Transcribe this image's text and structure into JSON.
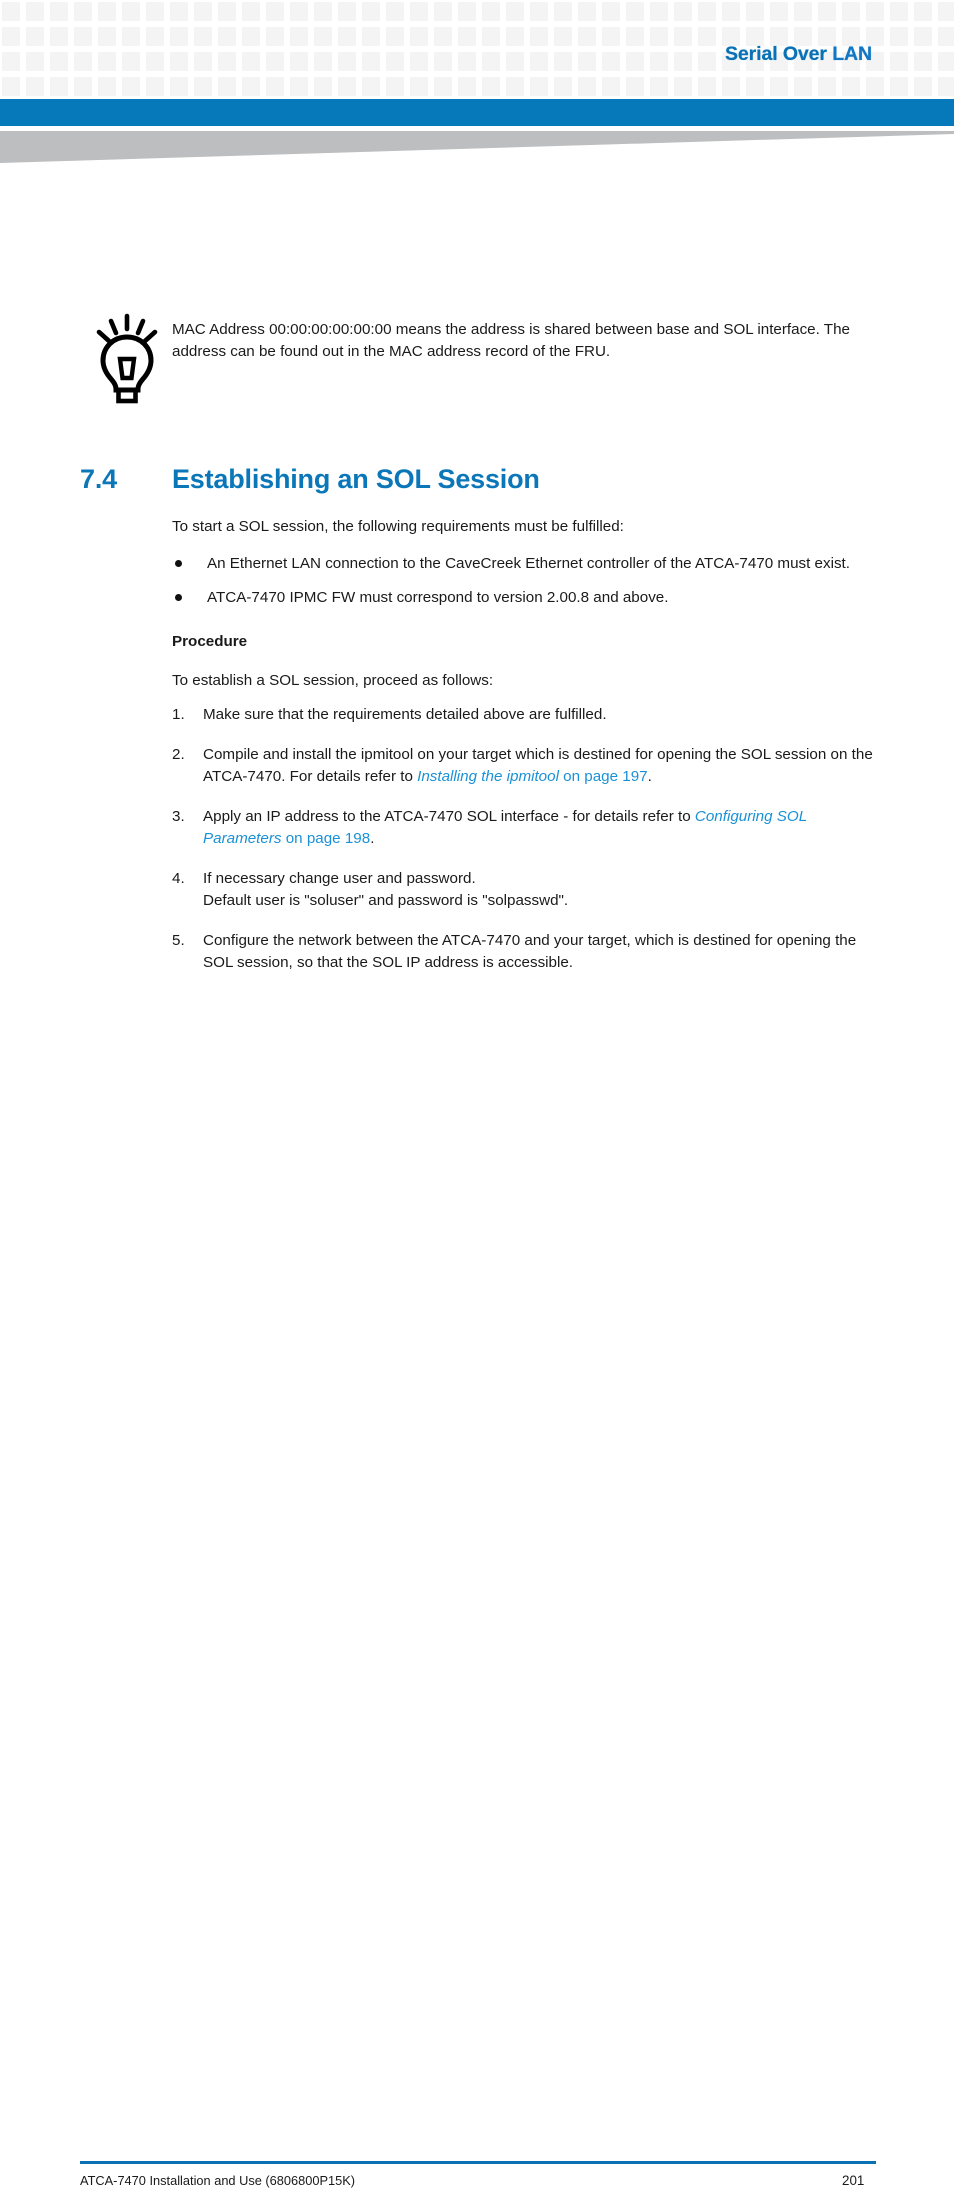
{
  "header": {
    "running_title": "Serial Over LAN",
    "running_title_head": "Serial Over ",
    "running_title_tail": "LAN",
    "accent_blue": "#0579ba",
    "title_blue": "#0a72b4",
    "wedge_gray": "#bcbec0",
    "grid_square_color": "#f4f4f4"
  },
  "tip": {
    "icon": "lightbulb-icon",
    "text": "MAC Address 00:00:00:00:00:00 means the address is shared between base and SOL interface. The address can be found out in the MAC address record of the FRU."
  },
  "section": {
    "number": "7.4",
    "title": "Establishing an SOL Session",
    "heading_color": "#0b77b8"
  },
  "body": {
    "intro": "To start a SOL session, the following requirements must be fulfilled:",
    "bullets": [
      "An Ethernet LAN connection to the CaveCreek Ethernet controller of the ATCA-7470 must exist.",
      "ATCA-7470 IPMC FW must correspond to version 2.00.8 and above."
    ],
    "procedure_heading": "Procedure",
    "procedure_intro": "To establish a SOL session, proceed as follows:",
    "steps": [
      {
        "num": "1.",
        "text": "Make sure that the requirements detailed above are fulfilled."
      },
      {
        "num": "2.",
        "text_before": "Compile and install the ipmitool on your target which is destined for opening the SOL session on the ATCA-7470. For details refer to ",
        "xref_italic": "Installing the ipmitool",
        "xref_plain": " on page 197",
        "text_after": "."
      },
      {
        "num": "3.",
        "text_before": "Apply an IP address to the ATCA-7470 SOL interface - for details refer to ",
        "xref_italic": "Configuring SOL Parameters",
        "xref_plain": " on page 198",
        "text_after": "."
      },
      {
        "num": "4.",
        "text": "If necessary change user and password.",
        "text_line2": "Default user is \"soluser\" and password is \"solpasswd\"."
      },
      {
        "num": "5.",
        "text": "Configure the network between the ATCA-7470 and your target, which is destined for opening the SOL session, so that the SOL IP address is accessible."
      }
    ],
    "link_color": "#1a91d6"
  },
  "footer": {
    "document_title": "ATCA-7470 Installation and Use (6806800P15K)",
    "page_number": "201",
    "rule_color": "#0a72b4"
  }
}
